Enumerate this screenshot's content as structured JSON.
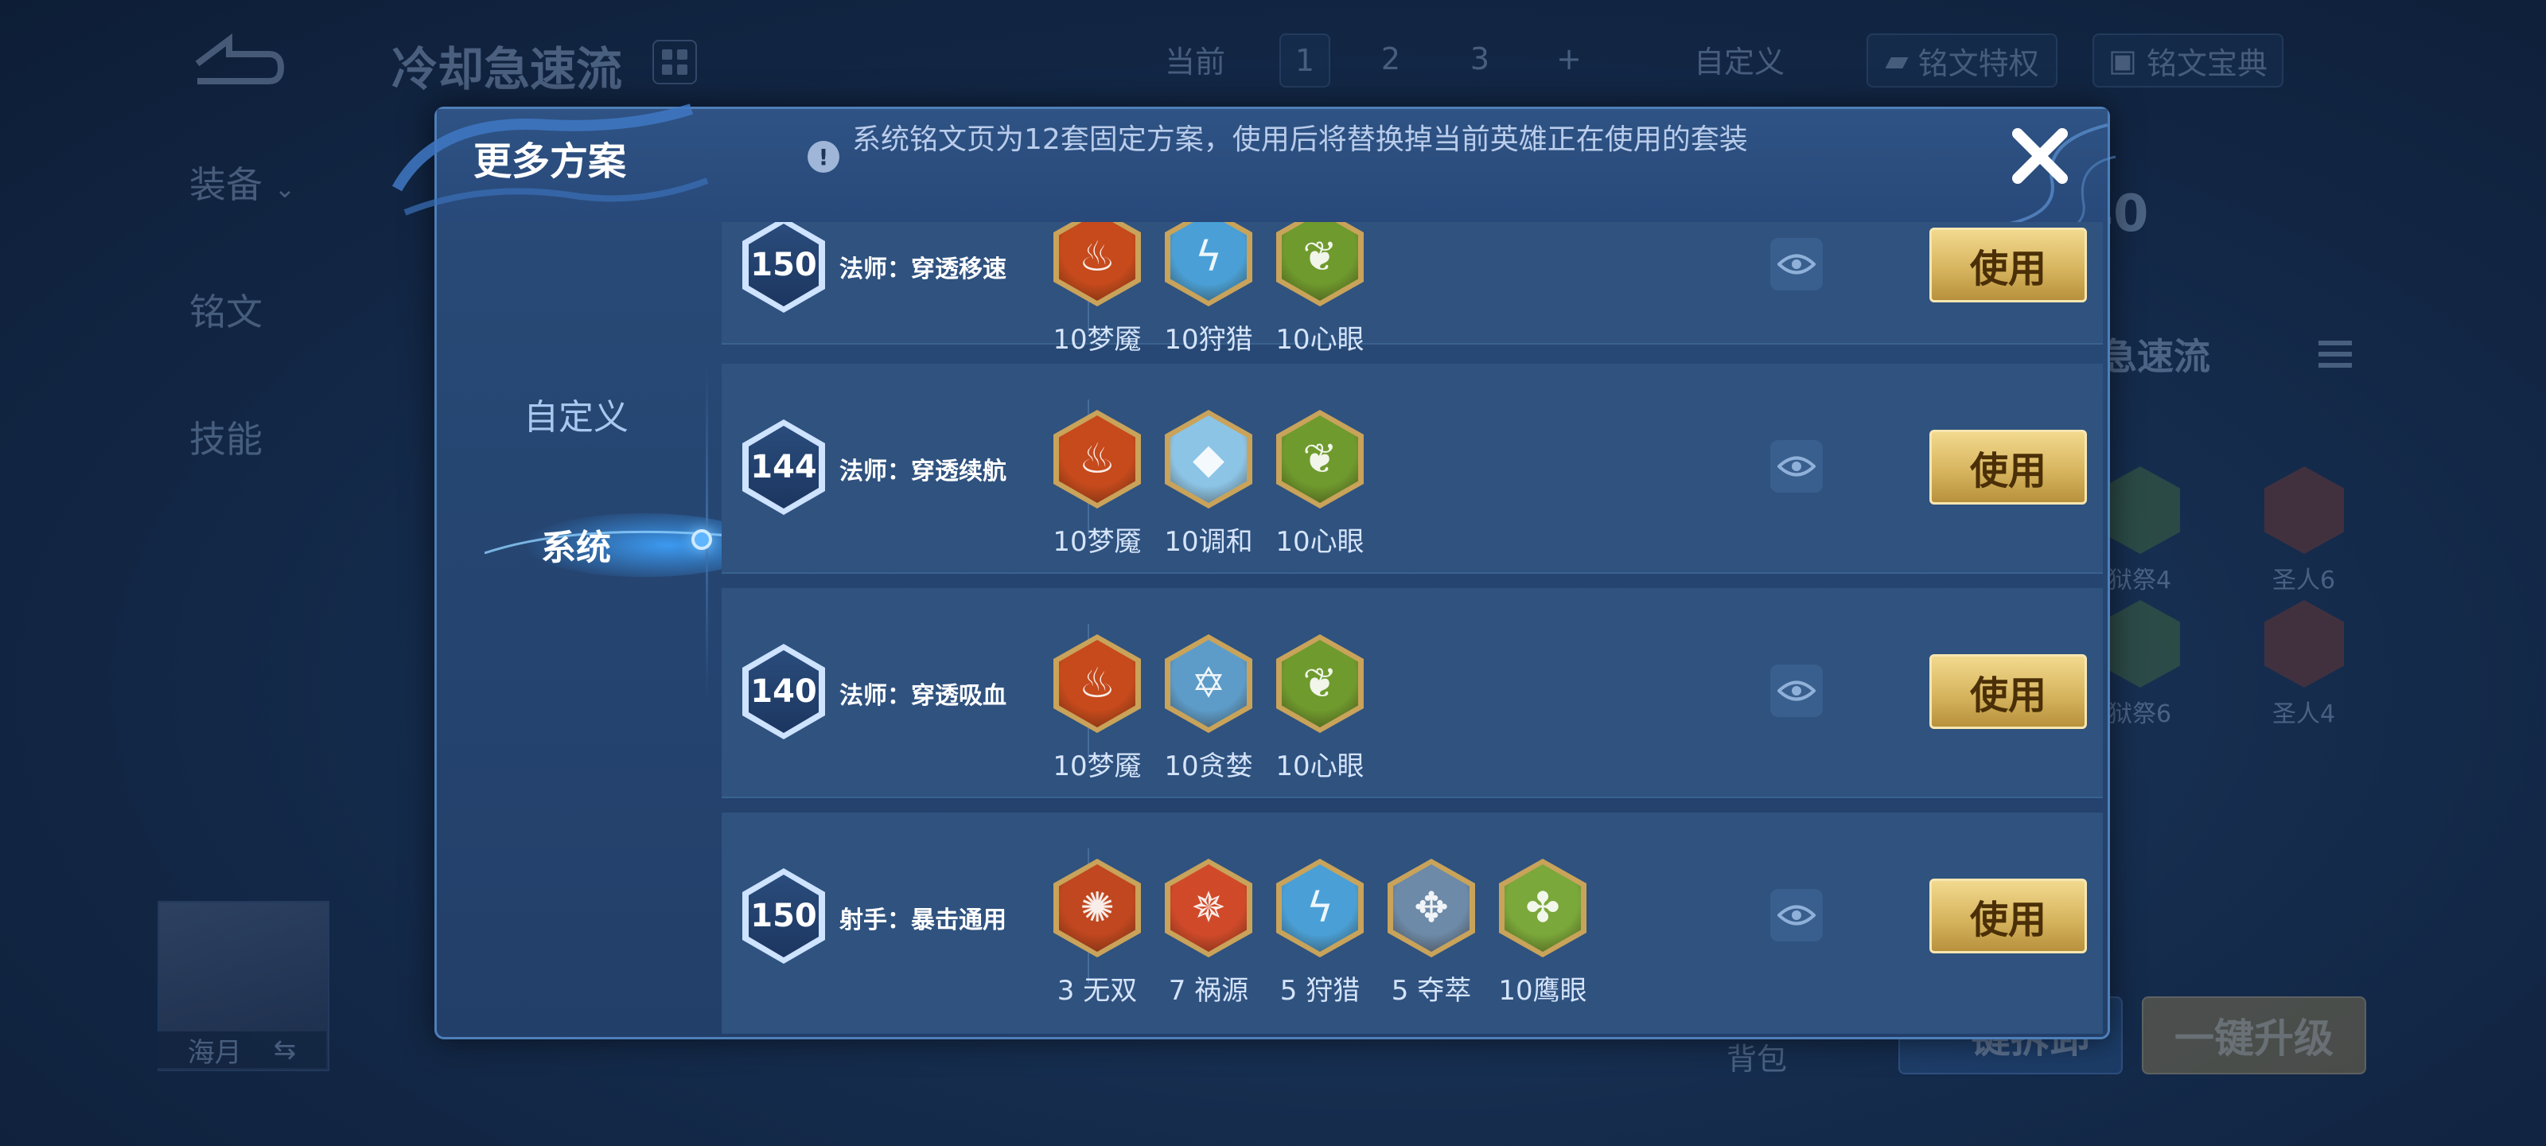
{
  "background": {
    "title": "冷却急速流",
    "topbar": {
      "current_label": "当前",
      "pages": [
        "1",
        "2",
        "3"
      ],
      "add_label": "+",
      "custom_label": "自定义",
      "privilege_label": "铭文特权",
      "codex_label": "铭文宝典"
    },
    "side_menu": [
      "装备",
      "铭文",
      "技能"
    ],
    "right_panel": {
      "level": "40",
      "name": "急速流",
      "gems": [
        {
          "label": "狱祭4",
          "color": "#4f7a3a"
        },
        {
          "label": "圣人6",
          "color": "#8a3b2b"
        },
        {
          "label": "狱祭6",
          "color": "#4f7a3a"
        },
        {
          "label": "圣人4",
          "color": "#8a3b2b"
        }
      ]
    },
    "hero_name": "海月",
    "swap_icon": "⇆",
    "bag_label": "背包",
    "equip_button": "一键拆卸",
    "upgrade_button": "一键升级"
  },
  "modal": {
    "title": "更多方案",
    "notice": "系统铭文页为12套固定方案，使用后将替换掉当前英雄正在使用的套装",
    "tabs": [
      "自定义",
      "系统"
    ],
    "active_tab": "系统",
    "use_label": "使用",
    "schemes": [
      {
        "level": "150",
        "name": "法师：穿透移速",
        "gems": [
          {
            "label": "10梦魇",
            "color": "#c64a1c",
            "icon": "flame-icon"
          },
          {
            "label": "10狩猎",
            "color": "#4aa0d6",
            "icon": "lightning-icon"
          },
          {
            "label": "10心眼",
            "color": "#6f9a2e",
            "icon": "leaf-icon"
          }
        ]
      },
      {
        "level": "144",
        "name": "法师：穿透续航",
        "gems": [
          {
            "label": "10梦魇",
            "color": "#c64a1c",
            "icon": "flame-icon"
          },
          {
            "label": "10调和",
            "color": "#8cc4e6",
            "icon": "drop-icon"
          },
          {
            "label": "10心眼",
            "color": "#6f9a2e",
            "icon": "leaf-icon"
          }
        ]
      },
      {
        "level": "140",
        "name": "法师：穿透吸血",
        "gems": [
          {
            "label": "10梦魇",
            "color": "#c64a1c",
            "icon": "flame-icon"
          },
          {
            "label": "10贪婪",
            "color": "#5d9cc9",
            "icon": "star-icon"
          },
          {
            "label": "10心眼",
            "color": "#6f9a2e",
            "icon": "leaf-icon"
          }
        ]
      },
      {
        "level": "150",
        "name": "射手：暴击通用",
        "gems": [
          {
            "label": "3 无双",
            "color": "#c0471f",
            "icon": "swirl-icon"
          },
          {
            "label": "7 祸源",
            "color": "#d04a2a",
            "icon": "claw-icon"
          },
          {
            "label": "5 狩猎",
            "color": "#4aa0d6",
            "icon": "lightning-icon"
          },
          {
            "label": "5 夺萃",
            "color": "#6d8aa8",
            "icon": "knot-icon"
          },
          {
            "label": "10鹰眼",
            "color": "#7aa83a",
            "icon": "clover-icon"
          }
        ]
      }
    ]
  }
}
